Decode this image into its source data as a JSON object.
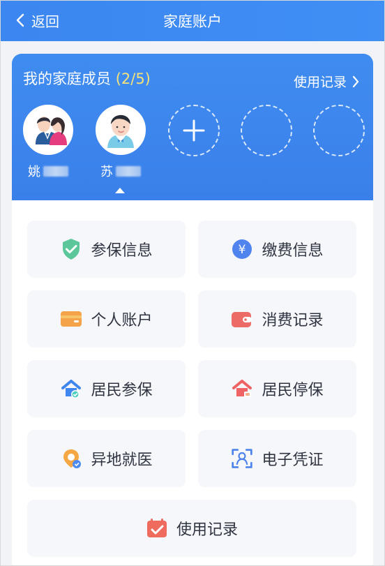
{
  "header": {
    "back_label": "返回",
    "title": "家庭账户"
  },
  "family": {
    "title": "我的家庭成员",
    "count": "(2/5)",
    "record_link": "使用记录",
    "members": [
      {
        "name": "姚"
      },
      {
        "name": "苏"
      }
    ]
  },
  "services": [
    {
      "label": "参保信息",
      "icon": "shield-check-icon"
    },
    {
      "label": "缴费信息",
      "icon": "yen-coin-icon"
    },
    {
      "label": "个人账户",
      "icon": "card-icon"
    },
    {
      "label": "消费记录",
      "icon": "wallet-icon"
    },
    {
      "label": "居民参保",
      "icon": "house-insurance-icon"
    },
    {
      "label": "居民停保",
      "icon": "house-stop-icon"
    },
    {
      "label": "异地就医",
      "icon": "location-medical-icon"
    },
    {
      "label": "电子凭证",
      "icon": "face-scan-icon"
    },
    {
      "label": "使用记录",
      "icon": "checklist-icon"
    }
  ],
  "colors": {
    "primary": "#3b86f0",
    "accent_count": "#f7e27a",
    "tile_background": "#f5f7fb"
  }
}
